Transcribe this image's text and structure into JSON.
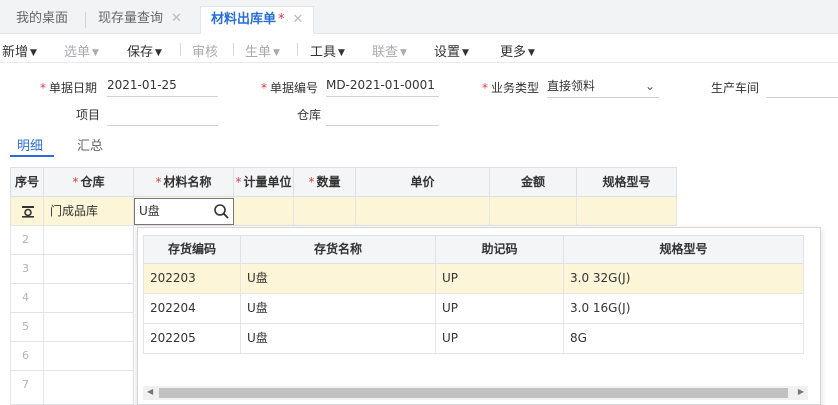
{
  "tabs": [
    {
      "label": "我的桌面",
      "closable": false,
      "active": false
    },
    {
      "label": "现存量查询",
      "closable": true,
      "active": false
    },
    {
      "label": "材料出库单",
      "modified_mark": "*",
      "closable": true,
      "active": true
    }
  ],
  "toolbar": {
    "new": "新增",
    "select": "选单",
    "save": "保存",
    "audit": "审核",
    "generate": "生单",
    "tools": "工具",
    "query": "联查",
    "settings": "设置",
    "more": "更多"
  },
  "form": {
    "date_label": "单据日期",
    "date_value": "2021-01-25",
    "number_label": "单据编号",
    "number_value": "MD-2021-01-0001",
    "biztype_label": "业务类型",
    "biztype_value": "直接领料",
    "workshop_label": "生产车间",
    "workshop_value": "",
    "project_label": "项目",
    "project_value": "",
    "warehouse_label": "仓库",
    "warehouse_value": ""
  },
  "subtabs": [
    "明细",
    "汇总"
  ],
  "grid": {
    "headers": {
      "seq": "序号",
      "warehouse": "仓库",
      "material": "材料名称",
      "unit": "计量单位",
      "qty": "数量",
      "price": "单价",
      "amount": "金额",
      "spec": "规格型号"
    },
    "row1": {
      "warehouse": "门成品库",
      "material": "U盘"
    },
    "row_numbers": [
      "2",
      "3",
      "4",
      "5",
      "6",
      "7"
    ]
  },
  "popup": {
    "headers": {
      "code": "存货编码",
      "name": "存货名称",
      "mnemonic": "助记码",
      "spec": "规格型号"
    },
    "rows": [
      {
        "code": "202203",
        "name": "U盘",
        "mnemonic": "UP",
        "spec": "3.0 32G(J)"
      },
      {
        "code": "202204",
        "name": "U盘",
        "mnemonic": "UP",
        "spec": "3.0 16G(J)"
      },
      {
        "code": "202205",
        "name": "U盘",
        "mnemonic": "UP",
        "spec": "8G"
      }
    ]
  },
  "colors": {
    "accent": "#2a6ed6",
    "required": "#e0393e",
    "highlight": "#fdf5d7"
  }
}
